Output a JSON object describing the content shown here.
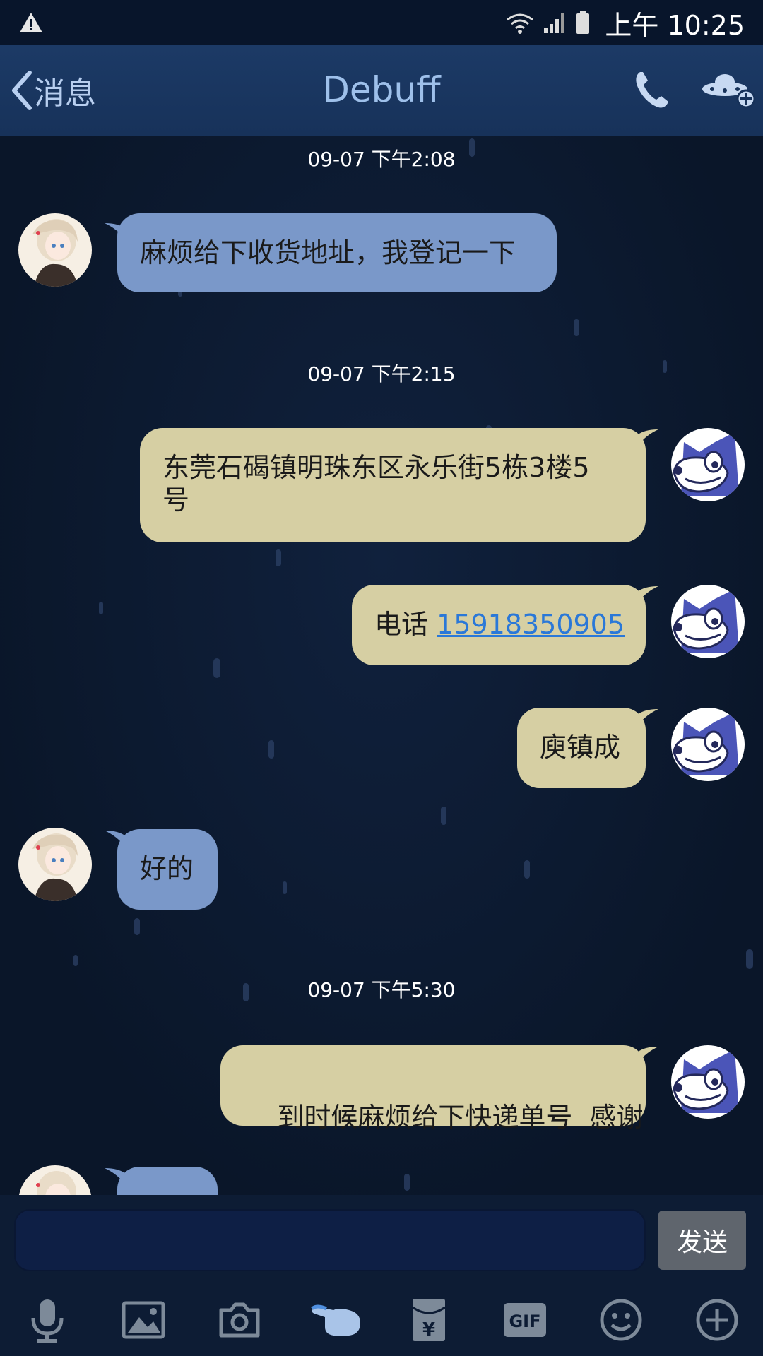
{
  "status_bar": {
    "time": "上午 10:25"
  },
  "nav": {
    "back_label": "消息",
    "title": "Debuff"
  },
  "messages": [
    {
      "type": "timestamp",
      "text": "09-07 下午2:08"
    },
    {
      "type": "incoming",
      "text": "麻烦给下收货地址，我登记一下"
    },
    {
      "type": "timestamp",
      "text": "09-07 下午2:15"
    },
    {
      "type": "outgoing",
      "line1": "东莞石碣镇明珠东区永乐街5栋3楼5",
      "line2": "号"
    },
    {
      "type": "outgoing",
      "prefix": "电话 ",
      "phone": "15918350905"
    },
    {
      "type": "outgoing",
      "text": "庾镇成"
    },
    {
      "type": "incoming",
      "text": "好的"
    },
    {
      "type": "timestamp",
      "text": "09-07 下午5:30"
    },
    {
      "type": "outgoing",
      "text": "到时候麻烦给下快递单号  感谢"
    }
  ],
  "input": {
    "send_label": "发送"
  },
  "toolbar": {
    "icons": [
      "microphone-icon",
      "image-icon",
      "camera-icon",
      "poke-hand-icon",
      "red-envelope-icon",
      "gif-icon",
      "emoji-icon",
      "plus-icon"
    ],
    "gif_label": "GIF",
    "envelope_label": "¥"
  },
  "colors": {
    "background": "#0b1930",
    "incoming_bubble": "#7a98c9",
    "outgoing_bubble": "#d6cfa3",
    "link": "#2a78d8",
    "nav_title": "#9ec0ea"
  }
}
